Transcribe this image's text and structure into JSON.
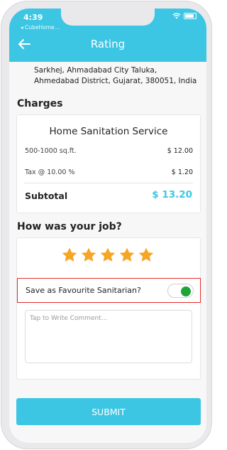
{
  "status_bar": {
    "time": "4:39",
    "app_name": "◂ CubeHome…"
  },
  "header": {
    "title": "Rating"
  },
  "address": "Sarkhej, Ahmadabad City Taluka, Ahmedabad District, Gujarat, 380051, India",
  "charges": {
    "section_title": "Charges",
    "service_name": "Home Sanitation Service",
    "items": [
      {
        "label": "500-1000 sq.ft.",
        "value": "$ 12.00"
      },
      {
        "label": "Tax @ 10.00 %",
        "value": "$ 1.20"
      }
    ],
    "subtotal_label": "Subtotal",
    "subtotal_value": "$ 13.20"
  },
  "rating": {
    "section_title": "How was your job?",
    "stars": 5,
    "star_color": "#f5a623",
    "favourite_label": "Save as Favourite Sanitarian?",
    "favourite_on": true,
    "comment_placeholder": "Tap to Write Comment..."
  },
  "submit_label": "SUBMIT",
  "colors": {
    "accent": "#3cc6e4",
    "toggle_on": "#1fa33a",
    "highlight": "#e52b2b"
  }
}
